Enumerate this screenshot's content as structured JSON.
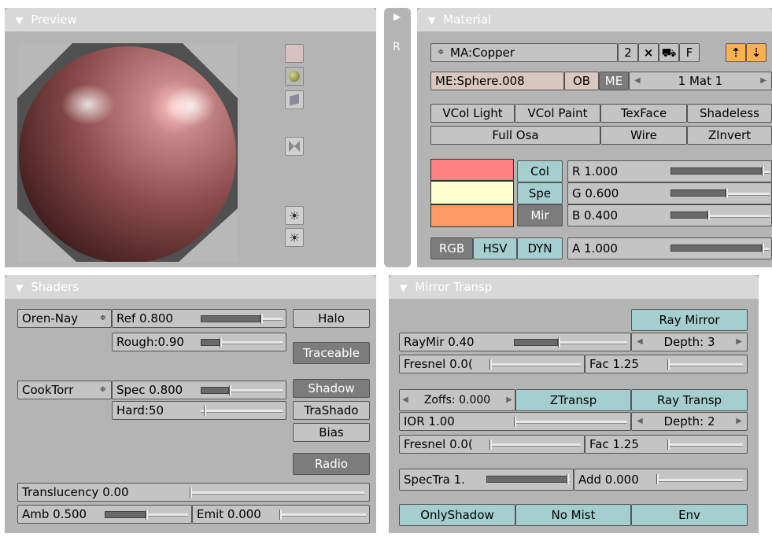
{
  "preview": {
    "title": "Preview"
  },
  "material": {
    "title": "Material",
    "tab_label": "R",
    "ma_name": "MA:Copper",
    "users": "2",
    "x_icon": "×",
    "fake_label": "F",
    "me_name": "ME:Sphere.008",
    "ob_label": "OB",
    "me_label": "ME",
    "mat_index": "1 Mat 1",
    "vcol_light": "VCol Light",
    "vcol_paint": "VCol Paint",
    "texface": "TexFace",
    "shadeless": "Shadeless",
    "full_osa": "Full Osa",
    "wire": "Wire",
    "zinvert": "ZInvert",
    "col": "Col",
    "spe": "Spe",
    "mir": "Mir",
    "r": "R 1.000",
    "g": "G 0.600",
    "b": "B 0.400",
    "a": "A 1.000",
    "rgb": "RGB",
    "hsv": "HSV",
    "dyn": "DYN",
    "swatch_colors": {
      "col": "#ff8080",
      "spe": "#ffffcc",
      "mir": "#ff9966"
    },
    "values": {
      "r": 1.0,
      "g": 0.6,
      "b": 0.4,
      "a": 1.0
    }
  },
  "shaders": {
    "title": "Shaders",
    "diffuse_shader": "Oren-Nay",
    "ref": "Ref  0.800",
    "rough": "Rough:0.90",
    "halo": "Halo",
    "traceable": "Traceable",
    "specular_shader": "CookTorr",
    "spec": "Spec 0.800",
    "hard": "Hard:50",
    "shadow": "Shadow",
    "trashado": "TraShado",
    "bias": "Bias",
    "radio": "Radio",
    "translucency": "Translucency 0.00",
    "amb": "Amb 0.500",
    "emit": "Emit 0.000"
  },
  "mirror": {
    "title": "Mirror Transp",
    "ray_mirror": "Ray Mirror",
    "raymir": "RayMir 0.40",
    "depth1": "Depth: 3",
    "fresnel1": "Fresnel 0.0(",
    "fac1": "Fac 1.25",
    "zoffs": "Zoffs: 0.000",
    "ztransp": "ZTransp",
    "ray_transp": "Ray Transp",
    "ior": "IOR 1.00",
    "depth2": "Depth: 2",
    "fresnel2": "Fresnel 0.0(",
    "fac2": "Fac 1.25",
    "spectra": "SpecTra 1.",
    "add": "Add 0.000",
    "onlyshadow": "OnlyShadow",
    "no_mist": "No Mist",
    "env": "Env"
  }
}
